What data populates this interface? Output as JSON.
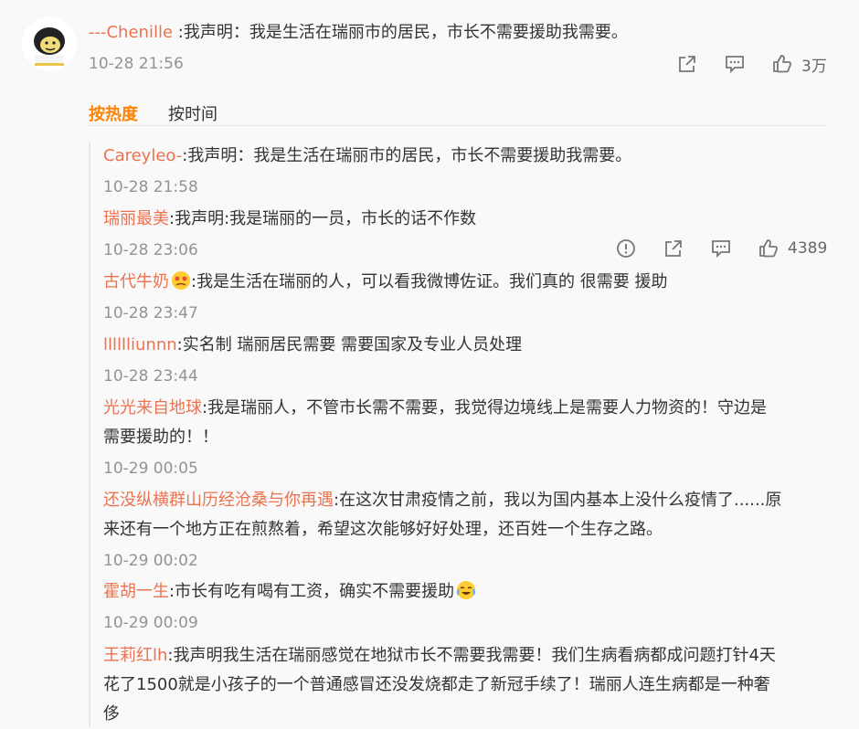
{
  "top_comment": {
    "username": "---Chenille",
    "text": " :我声明：我是生活在瑞丽市的居民，市长不需要援助我需要。",
    "time": "10-28 21:56",
    "like_count": "3万"
  },
  "sort": {
    "hot_label": "按热度",
    "time_label": "按时间"
  },
  "replies": [
    {
      "username": "Careyleo-",
      "text": ":我声明：我是生活在瑞丽市的居民，市长不需要援助我需要。",
      "time": "10-28 21:58"
    },
    {
      "username": "瑞丽最美",
      "text": ":我声明:我是瑞丽的一员，市长的话不作数",
      "time": "10-28 23:06",
      "like_count": "4389"
    },
    {
      "username": "古代牛奶",
      "text": ":我是生活在瑞丽的人，可以看我微博佐证。我们真的 很需要 援助",
      "time": "10-28 23:47"
    },
    {
      "username": "lllllliunnn",
      "text": ":实名制 瑞丽居民需要 需要国家及专业人员处理",
      "time": "10-28 23:44"
    },
    {
      "username": "光光来自地球",
      "text_line1": ":我是瑞丽人，不管市长需不需要，我觉得边境线上是需要人力物资的！守边是",
      "text_line2": "需要援助的！！",
      "time": "10-29 00:05"
    },
    {
      "username": "还没纵横群山历经沧桑与你再遇",
      "text_line1": ":在这次甘肃疫情之前，我以为国内基本上没什么疫情了......原",
      "text_line2": "来还有一个地方正在煎熬着，希望这次能够好好处理，还百姓一个生存之路。",
      "time": "10-29 00:02"
    },
    {
      "username": "霍胡一生",
      "text": ":市长有吃有喝有工资，确实不需要援助",
      "time": "10-29 00:09"
    },
    {
      "username": "王莉红lh",
      "text_line1": ":我声明我生活在瑞丽感觉在地狱市长不需要我需要！我们生病看病都成问题打针4天",
      "text_line2": "花了1500就是小孩子的一个普通感冒还没发烧都走了新冠手续了！瑞丽人连生病都是一种奢",
      "text_line3": "侈"
    }
  ],
  "colors": {
    "username": "#eb7350",
    "active_sort": "#ff8200",
    "time": "#939393"
  },
  "icons": [
    "share-icon",
    "comment-icon",
    "like-icon",
    "report-icon"
  ]
}
